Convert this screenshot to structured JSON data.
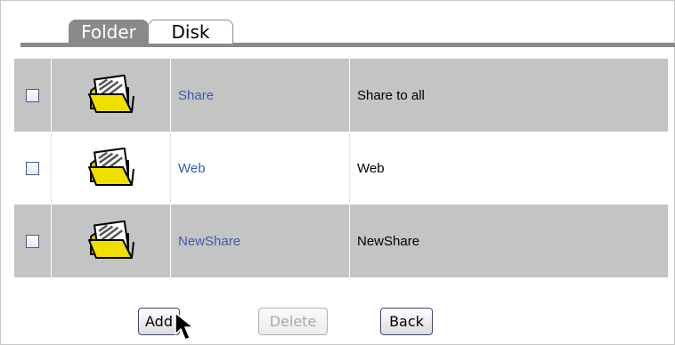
{
  "tabs": {
    "folder": "Folder",
    "disk": "Disk",
    "active": "Folder"
  },
  "shares": [
    {
      "name": "Share",
      "description": "Share to all",
      "checked": false,
      "icon": "folder-icon"
    },
    {
      "name": "Web",
      "description": "Web",
      "checked": false,
      "icon": "folder-icon"
    },
    {
      "name": "NewShare",
      "description": "NewShare",
      "checked": false,
      "icon": "folder-icon"
    }
  ],
  "buttons": {
    "add": "Add",
    "delete": "Delete",
    "back": "Back",
    "delete_enabled": false
  },
  "colors": {
    "tab_active_bg": "#8a8a8a",
    "row_shaded_bg": "#c4c4c4",
    "link": "#3a5fa8",
    "folder_yellow": "#f0e000"
  }
}
